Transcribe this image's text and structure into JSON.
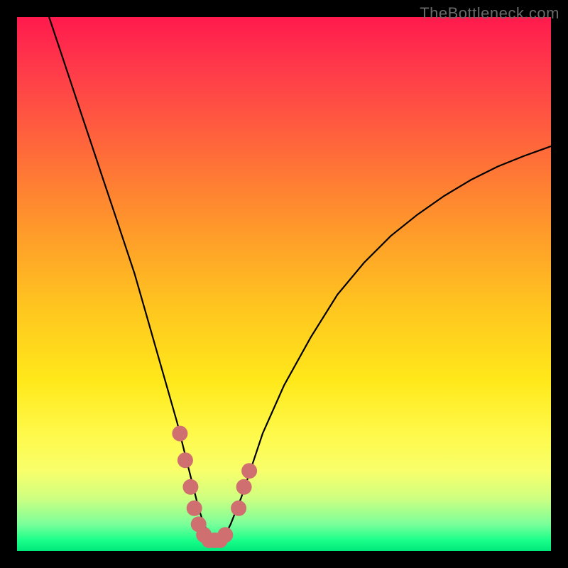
{
  "watermark": "TheBottleneck.com",
  "chart_data": {
    "type": "line",
    "title": "",
    "xlabel": "",
    "ylabel": "",
    "xlim": [
      0,
      100
    ],
    "ylim": [
      0,
      100
    ],
    "series": [
      {
        "name": "bottleneck-curve",
        "x": [
          6,
          8,
          10,
          12,
          14,
          16,
          18,
          20,
          22,
          24,
          26,
          28,
          30,
          32,
          33,
          34,
          35,
          36,
          37,
          38,
          39,
          40,
          42,
          44,
          46,
          50,
          55,
          60,
          65,
          70,
          75,
          80,
          85,
          90,
          95,
          100
        ],
        "y": [
          100,
          94,
          88,
          82,
          76,
          70,
          64,
          58,
          52,
          45,
          38,
          31,
          24,
          16,
          12,
          8,
          5,
          3,
          2,
          2,
          3,
          5,
          10,
          16,
          22,
          31,
          40,
          48,
          54,
          59,
          63,
          66.5,
          69.5,
          72,
          74,
          75.8
        ]
      }
    ],
    "markers": {
      "name": "highlight-dots",
      "color": "#cf6f6f",
      "points": [
        {
          "x": 30.5,
          "y": 22
        },
        {
          "x": 31.5,
          "y": 17
        },
        {
          "x": 32.5,
          "y": 12
        },
        {
          "x": 33.2,
          "y": 8
        },
        {
          "x": 34.0,
          "y": 5
        },
        {
          "x": 35.0,
          "y": 3
        },
        {
          "x": 36.0,
          "y": 2
        },
        {
          "x": 37.0,
          "y": 2
        },
        {
          "x": 38.0,
          "y": 2
        },
        {
          "x": 39.0,
          "y": 3
        },
        {
          "x": 41.5,
          "y": 8
        },
        {
          "x": 42.5,
          "y": 12
        },
        {
          "x": 43.5,
          "y": 15
        }
      ]
    }
  }
}
